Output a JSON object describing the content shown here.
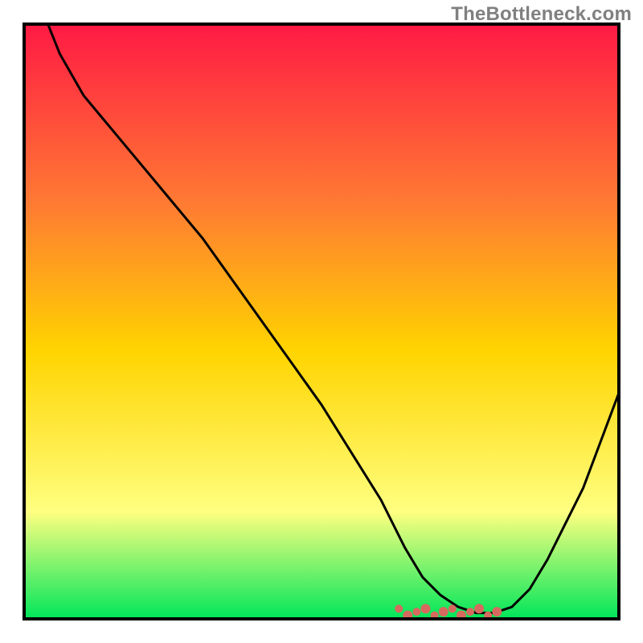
{
  "watermark": "TheBottleneck.com",
  "colors": {
    "gradient_top": "#ff1a44",
    "gradient_mid1": "#ff7a33",
    "gradient_mid2": "#ffd400",
    "gradient_mid3": "#ffff80",
    "gradient_bottom": "#00e65a",
    "curve_stroke": "#000000",
    "dots_fill": "#d76a5e",
    "frame_stroke": "#000000"
  },
  "chart_data": {
    "type": "line",
    "title": "",
    "xlabel": "",
    "ylabel": "",
    "xlim": [
      0,
      100
    ],
    "ylim": [
      0,
      100
    ],
    "series": [
      {
        "name": "bottleneck-curve",
        "x": [
          4,
          6,
          10,
          15,
          20,
          25,
          30,
          35,
          40,
          45,
          50,
          55,
          60,
          64,
          67,
          70,
          73,
          76,
          79,
          82,
          85,
          88,
          91,
          94,
          97,
          100
        ],
        "values": [
          100,
          95,
          88,
          82,
          76,
          70,
          64,
          57,
          50,
          43,
          36,
          28,
          20,
          12,
          7,
          4,
          2,
          1,
          1,
          2,
          5,
          10,
          16,
          22,
          30,
          38
        ]
      }
    ],
    "annotations": {
      "optimal_cluster_x_range": [
        63,
        80
      ],
      "optimal_cluster_y": 1
    },
    "grid": false,
    "legend": false
  }
}
